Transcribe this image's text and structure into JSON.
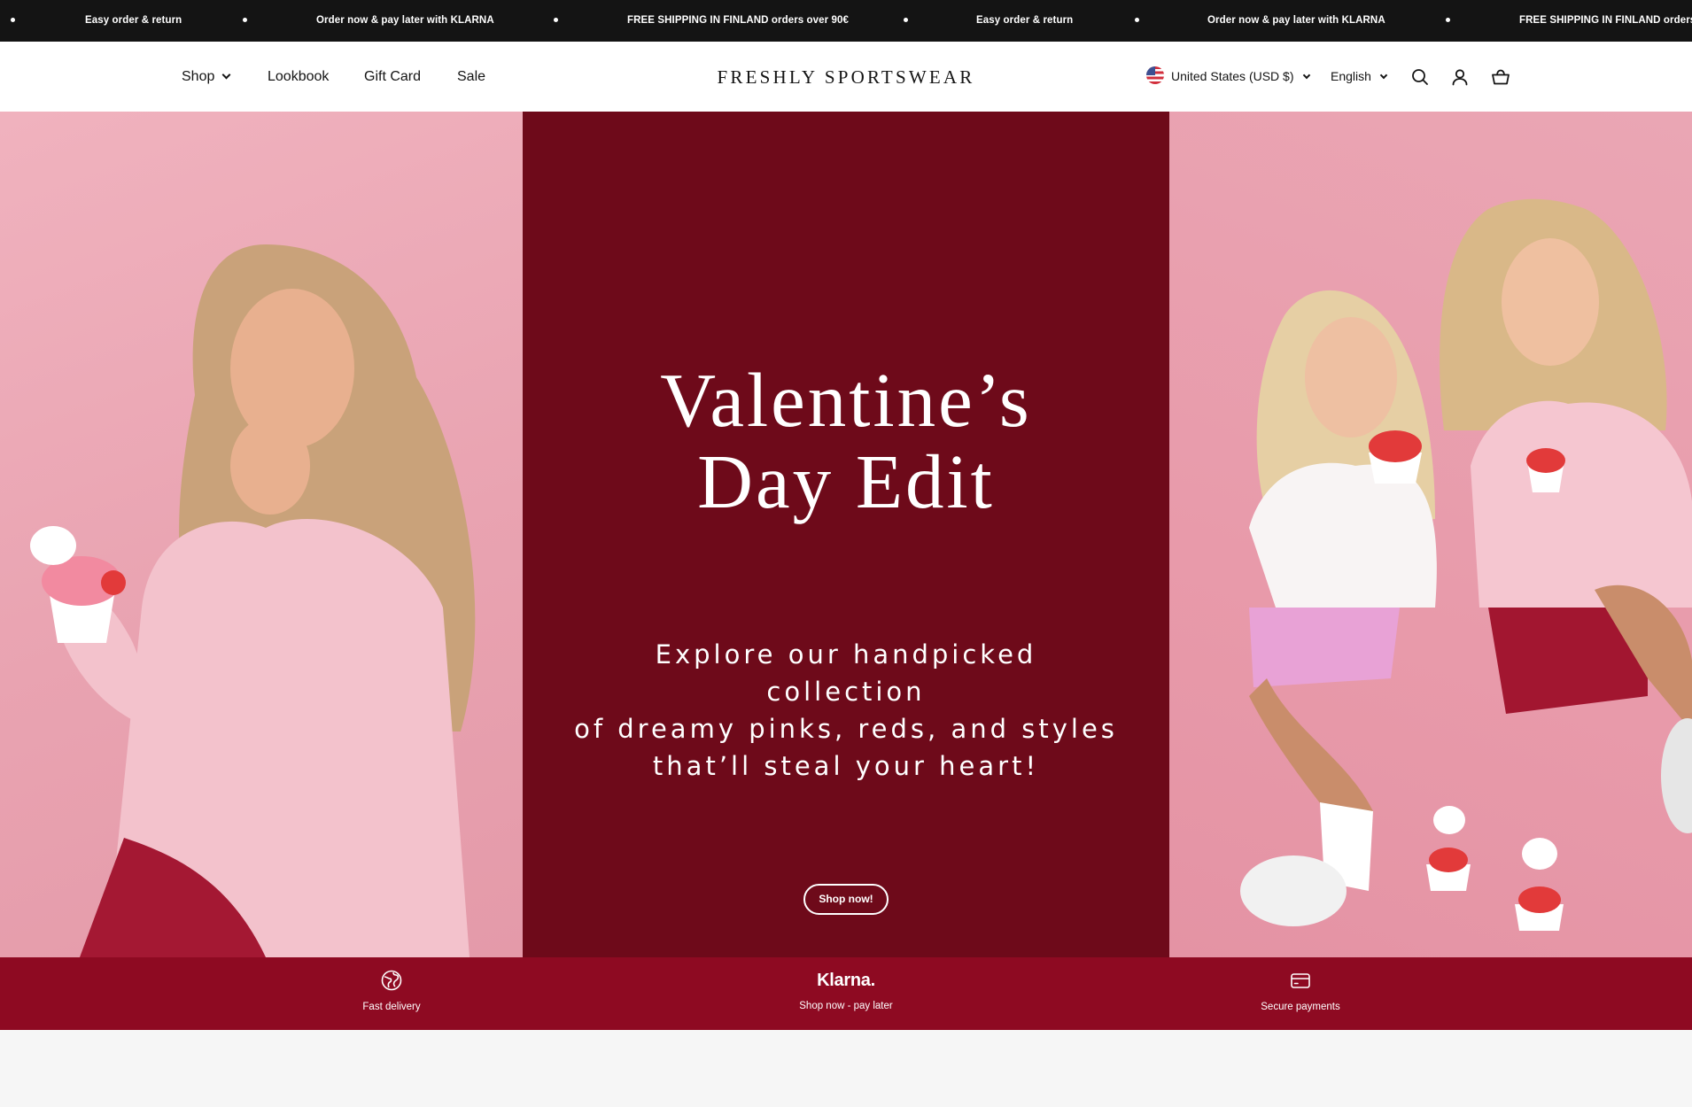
{
  "announcement": {
    "messages": [
      "Easy order & return",
      "Order now & pay later with KLARNA",
      "FREE SHIPPING IN FINLAND orders over 90€",
      "Easy order & return",
      "Order now & pay later with KLARNA",
      "FREE SHIPPING IN FINLAND orders o"
    ]
  },
  "header": {
    "nav": [
      "Shop",
      "Lookbook",
      "Gift Card",
      "Sale"
    ],
    "logo": "FRESHLY SPORTSWEAR",
    "country": "United States (USD $)",
    "language": "English",
    "icons": [
      "search-icon",
      "account-icon",
      "cart-icon"
    ]
  },
  "hero": {
    "title_line1": "Valentine’s",
    "title_line2": "Day Edit",
    "subtitle_line1": "Explore our handpicked collection",
    "subtitle_line2": "of dreamy pinks, reds, and styles",
    "subtitle_line3": "that’ll steal your heart!",
    "button": "Shop now!"
  },
  "usp": [
    {
      "icon": "globe-delivery-icon",
      "text": "Fast delivery"
    },
    {
      "icon": "klarna-logo",
      "logo_text": "Klarna.",
      "text": "Shop now - pay later"
    },
    {
      "icon": "credit-card-icon",
      "text": "Secure payments"
    }
  ],
  "colors": {
    "announce_bg": "#141414",
    "hero_mid": "#6e0a1a",
    "usp_bg": "#8e0a22",
    "pink": "#eaa6b4"
  }
}
